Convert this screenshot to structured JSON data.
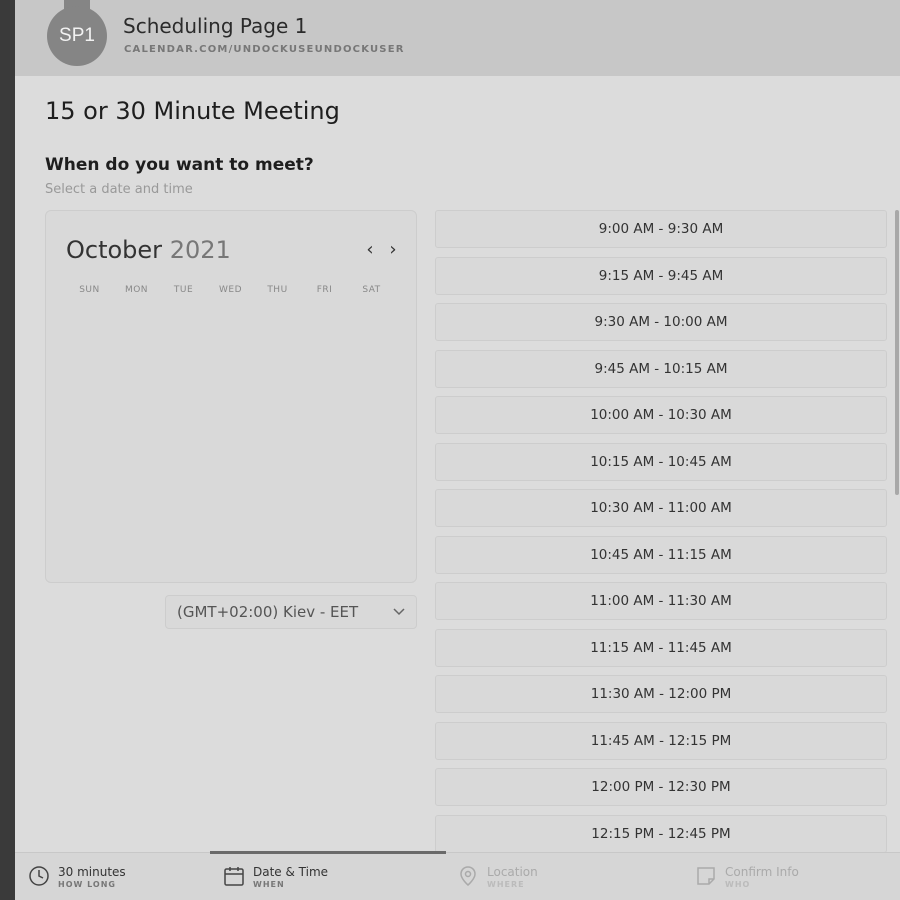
{
  "header": {
    "avatar_text": "SP1",
    "title": "Scheduling Page 1",
    "url": "CALENDAR.COM/UNDOCKUSEUNDOCKUSER"
  },
  "meeting_title": "15 or 30 Minute Meeting",
  "question": "When do you want to meet?",
  "question_sub": "Select a date and time",
  "calendar": {
    "month": "October",
    "year": "2021",
    "days": [
      "SUN",
      "MON",
      "TUE",
      "WED",
      "THU",
      "FRI",
      "SAT"
    ],
    "prev_icon": "chevron-left-icon",
    "next_icon": "chevron-right-icon"
  },
  "timezone": {
    "value": "(GMT+02:00) Kiev - EET"
  },
  "time_slots": [
    "9:00 AM - 9:30 AM",
    "9:15 AM - 9:45 AM",
    "9:30 AM - 10:00 AM",
    "9:45 AM - 10:15 AM",
    "10:00 AM - 10:30 AM",
    "10:15 AM - 10:45 AM",
    "10:30 AM - 11:00 AM",
    "10:45 AM - 11:15 AM",
    "11:00 AM - 11:30 AM",
    "11:15 AM - 11:45 AM",
    "11:30 AM - 12:00 PM",
    "11:45 AM - 12:15 PM",
    "12:00 PM - 12:30 PM",
    "12:15 PM - 12:45 PM"
  ],
  "footer": {
    "steps": [
      {
        "label": "30 minutes",
        "sub": "HOW LONG",
        "icon": "clock-icon"
      },
      {
        "label": "Date & Time",
        "sub": "WHEN",
        "icon": "calendar-icon"
      },
      {
        "label": "Location",
        "sub": "WHERE",
        "icon": "location-pin-icon"
      },
      {
        "label": "Confirm Info",
        "sub": "WHO",
        "icon": "note-icon"
      }
    ]
  }
}
